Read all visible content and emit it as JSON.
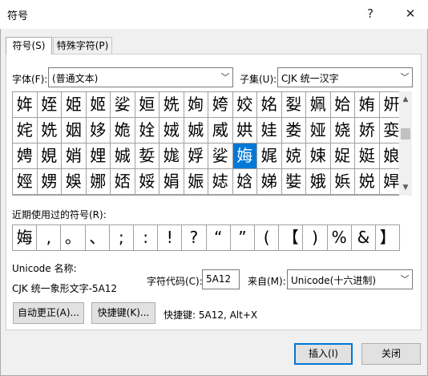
{
  "window": {
    "title": "符号",
    "help_label": "?",
    "close_label": "✕"
  },
  "tabs": [
    {
      "label": "符号(S)",
      "underline": "S"
    },
    {
      "label": "特殊字符(P)",
      "underline": "P"
    }
  ],
  "font": {
    "label": "字体(F):",
    "value": "(普通文本)"
  },
  "subset": {
    "label": "子集(U):",
    "value": "CJK 统一汉字"
  },
  "grid": [
    [
      "姩",
      "姪",
      "姫",
      "姬",
      "娑",
      "姮",
      "姺",
      "姰",
      "姱",
      "姣",
      "姳",
      "姴",
      "姵",
      "姶",
      "姷",
      "姸"
    ],
    [
      "姹",
      "姺",
      "姻",
      "姼",
      "姽",
      "姾",
      "娀",
      "娍",
      "威",
      "娂",
      "娃",
      "娄",
      "娅",
      "娆",
      "娇",
      "娈"
    ],
    [
      "娉",
      "娊",
      "娋",
      "娌",
      "娍",
      "娎",
      "娏",
      "娐",
      "娑",
      "娒",
      "娓",
      "娔",
      "娕",
      "娖",
      "娗",
      "娘"
    ],
    [
      "娙",
      "娚",
      "娛",
      "娜",
      "娝",
      "娞",
      "娟",
      "娠",
      "娡",
      "娢",
      "娣",
      "娤",
      "娥",
      "娦",
      "娧",
      "娨"
    ]
  ],
  "selected": {
    "row": 2,
    "col": 9,
    "char": "娒"
  },
  "recent": {
    "label": "近期使用过的符号(R):",
    "symbols": [
      "娒",
      ",",
      "。",
      "、",
      ";",
      ":",
      "!",
      "?",
      "“",
      "”",
      "(",
      "【",
      ")",
      "%",
      "&",
      "】"
    ]
  },
  "unicode_name": {
    "label": "Unicode 名称:",
    "value": "CJK 统一象形文字-5A12"
  },
  "char_code": {
    "label": "字符代码(C):",
    "value": "5A12"
  },
  "from": {
    "label": "来自(M):",
    "value": "Unicode(十六进制)"
  },
  "buttons": {
    "autocorrect": "自动更正(A)...",
    "shortcut_key": "快捷键(K)...",
    "insert": "插入(I)",
    "close": "关闭"
  },
  "shortcut_info": "快捷键: 5A12, Alt+X"
}
